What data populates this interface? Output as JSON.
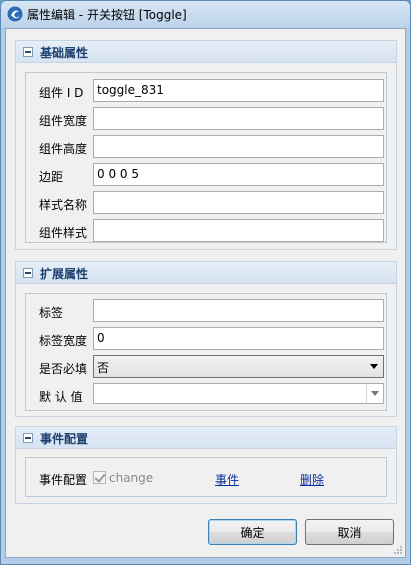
{
  "window": {
    "title": "属性编辑 - 开关按钮 [Toggle]"
  },
  "groups": {
    "basic": {
      "title": "基础属性",
      "fields": [
        {
          "label": "组件 I D",
          "value": "toggle_831"
        },
        {
          "label": "组件宽度",
          "value": ""
        },
        {
          "label": "组件高度",
          "value": ""
        },
        {
          "label": "边距",
          "value": "0 0 0 5"
        },
        {
          "label": "样式名称",
          "value": ""
        },
        {
          "label": "组件样式",
          "value": ""
        }
      ]
    },
    "extended": {
      "title": "扩展属性",
      "label_field": {
        "label": "标签",
        "value": ""
      },
      "label_width": {
        "label": "标签宽度",
        "value": "0"
      },
      "required": {
        "label": "是否必填",
        "selected": "否"
      },
      "default": {
        "label": "默 认 值",
        "value": ""
      }
    },
    "events": {
      "title": "事件配置",
      "row_label": "事件配置",
      "checkbox_label": "change",
      "checkbox_checked": true,
      "event_link": "事件",
      "delete_link": "删除"
    }
  },
  "buttons": {
    "ok": "确定",
    "cancel": "取消"
  },
  "icons": {
    "app": "app-logo-icon",
    "collapse": "collapse-minus-icon",
    "dropdown": "chevron-down-icon",
    "resize": "resize-grip-icon"
  }
}
